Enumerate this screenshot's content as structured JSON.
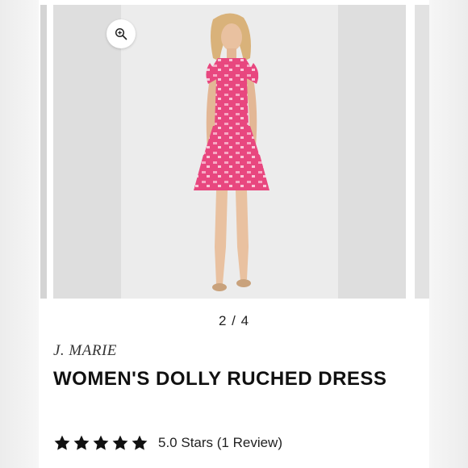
{
  "gallery": {
    "counter": "2 / 4",
    "zoom_icon": "zoom-in-icon",
    "image_alt": "Model wearing pink printed ruched dress"
  },
  "product": {
    "brand": "J. MARIE",
    "title": "WOMEN'S DOLLY RUCHED DRESS"
  },
  "rating": {
    "stars": 5,
    "max_stars": 5,
    "text": "5.0 Stars (1 Review)"
  },
  "colors": {
    "dress_pink": "#e8477f",
    "dress_light": "#f7a8c4",
    "star": "#111111"
  }
}
